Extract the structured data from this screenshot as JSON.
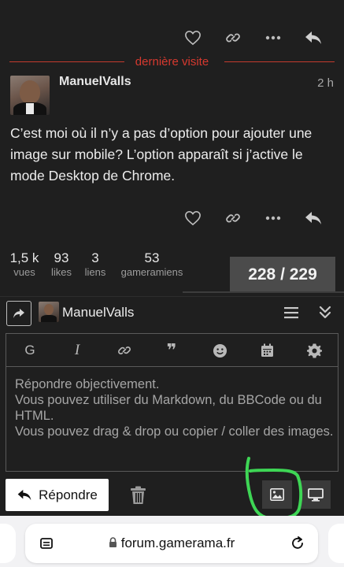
{
  "post_actions_top": {
    "like_icon": "heart-icon",
    "link_icon": "link-icon",
    "more_icon": "ellipsis-icon",
    "reply_icon": "reply-arrow-icon"
  },
  "last_visit_label": "dernière visite",
  "post": {
    "username": "ManuelValls",
    "time": "2 h",
    "text": "C’est moi où il n’y a pas d’option pour ajouter une image sur mobile? L’option apparaît si j’active le mode Desktop de Chrome."
  },
  "stats": [
    {
      "value": "1,5 k",
      "label": "vues"
    },
    {
      "value": "93",
      "label": "likes"
    },
    {
      "value": "3",
      "label": "liens"
    },
    {
      "value": "53",
      "label": "gameramiens"
    }
  ],
  "progress": "228 / 229",
  "composer": {
    "username": "ManuelValls",
    "toolbar": {
      "heading": "G",
      "italic": "I",
      "quote": "❞"
    },
    "placeholder_lines": [
      "Répondre objectivement.",
      "Vous pouvez utiliser du Markdown, du BBCode ou du HTML.",
      "Vous pouvez drag & drop ou copier / coller des images."
    ],
    "reply_button": "Répondre"
  },
  "browser": {
    "url": "forum.gamerama.fr"
  },
  "colors": {
    "background": "#1f1f1f",
    "accent_red": "#d6392f",
    "annotation_green": "#3ed655"
  }
}
